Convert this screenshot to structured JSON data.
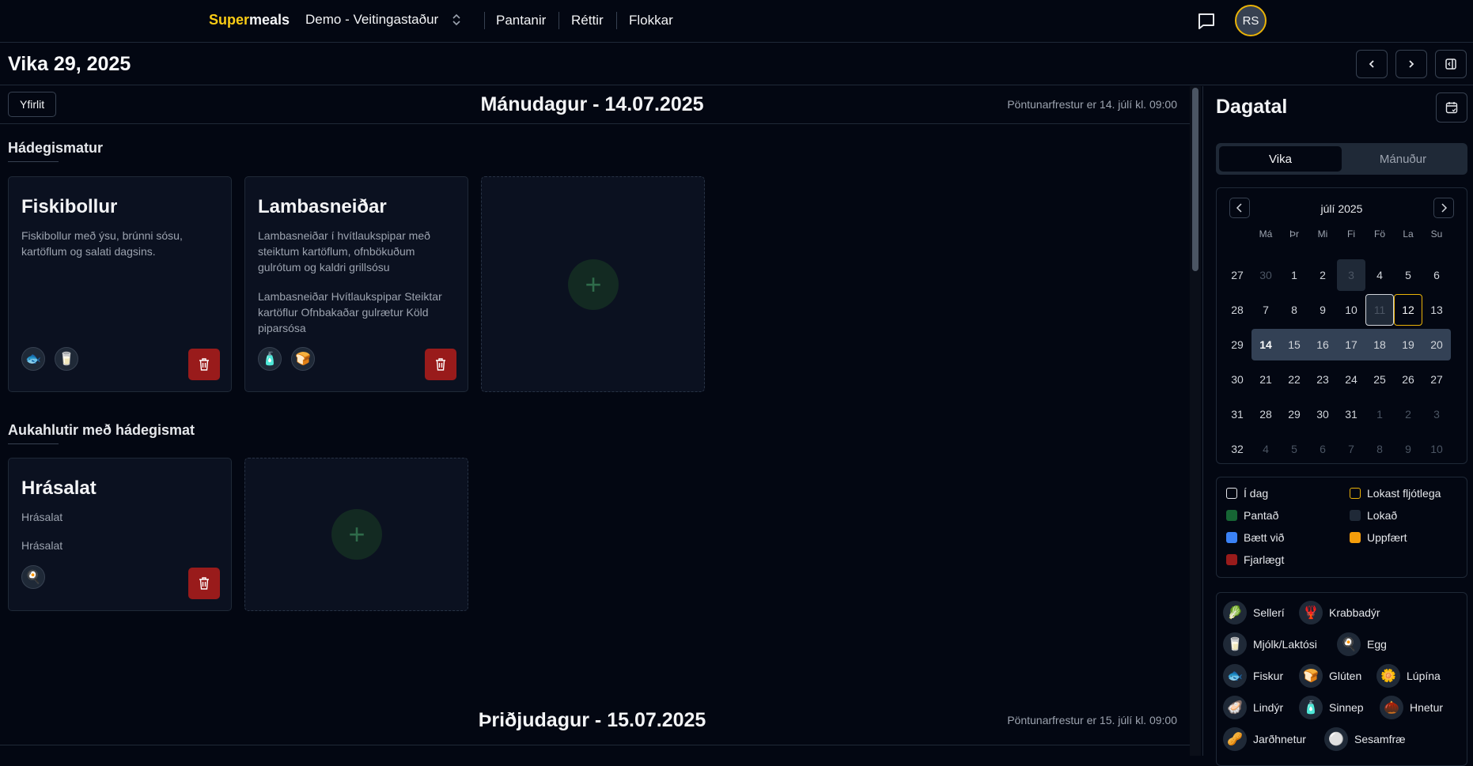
{
  "header": {
    "brand_a": "Super",
    "brand_b": "meals",
    "venue": "Demo - Veitingastaður",
    "nav": [
      "Pantanir",
      "Réttir",
      "Flokkar"
    ],
    "avatar": "RS"
  },
  "week": {
    "title": "Vika 29, 2025"
  },
  "day1": {
    "overview_button": "Yfirlit",
    "title": "Mánudagur - 14.07.2025",
    "deadline": "Pöntunarfrestur er 14. júlí kl. 09:00",
    "sections": [
      {
        "name": "Hádegismatur",
        "cards": [
          {
            "title": "Fiskibollur",
            "desc": "Fiskibollur með ýsu, brúnni sósu, kartöflum og salati dagsins.",
            "desc2": "",
            "allergens": [
              "fish-icon",
              "milk-icon"
            ]
          },
          {
            "title": "Lambasneiðar",
            "desc": "Lambasneiðar í hvítlaukspipar með steiktum kartöflum, ofnbökuðum gulrótum og kaldri grillsósu",
            "desc2": "Lambasneiðar Hvítlaukspipar Steiktar kartöflur Ofnbakaðar gulrætur Köld piparsósa",
            "allergens": [
              "mustard-icon",
              "gluten-icon"
            ]
          }
        ]
      },
      {
        "name": "Aukahlutir með hádegismat",
        "cards": [
          {
            "title": "Hrásalat",
            "desc": "Hrásalat",
            "desc2": "Hrásalat",
            "allergens": [
              "egg-icon"
            ]
          }
        ]
      }
    ]
  },
  "day2": {
    "title": "Þriðjudagur - 15.07.2025",
    "deadline": "Pöntunarfrestur er 15. júlí kl. 09:00"
  },
  "sidebar": {
    "title": "Dagatal",
    "tabs": [
      "Vika",
      "Mánuður"
    ],
    "active_tab": "Vika",
    "calendar": {
      "month": "júlí 2025",
      "weekdays": [
        "Má",
        "Þr",
        "Mi",
        "Fi",
        "Fö",
        "La",
        "Su"
      ],
      "weeks": [
        {
          "wk": "27",
          "days": [
            "30",
            "1",
            "2",
            "3",
            "4",
            "5",
            "6"
          ]
        },
        {
          "wk": "28",
          "days": [
            "7",
            "8",
            "9",
            "10",
            "11",
            "12",
            "13"
          ]
        },
        {
          "wk": "29",
          "days": [
            "14",
            "15",
            "16",
            "17",
            "18",
            "19",
            "20"
          ]
        },
        {
          "wk": "30",
          "days": [
            "21",
            "22",
            "23",
            "24",
            "25",
            "26",
            "27"
          ]
        },
        {
          "wk": "31",
          "days": [
            "28",
            "29",
            "30",
            "31",
            "1",
            "2",
            "3"
          ]
        },
        {
          "wk": "32",
          "days": [
            "4",
            "5",
            "6",
            "7",
            "8",
            "9",
            "10"
          ]
        }
      ],
      "today": "11",
      "closing_soon": "12",
      "selected_week": "29"
    },
    "legend": [
      {
        "label": "Í dag",
        "color": "#030712"
      },
      {
        "label": "Lokast fljótlega",
        "color": "#eab308"
      },
      {
        "label": "Pantað",
        "color": "#166534"
      },
      {
        "label": "Lokað",
        "color": "#1f2937"
      },
      {
        "label": "Bætt við",
        "color": "#3b82f6"
      },
      {
        "label": "Uppfært",
        "color": "#f59e0b"
      },
      {
        "label": "Fjarlægt",
        "color": "#991b1b"
      }
    ],
    "allergens": [
      {
        "label": "Sellerí",
        "icon": "celery-icon",
        "glyph": "🥬"
      },
      {
        "label": "Krabbadýr",
        "icon": "crustacean-icon",
        "glyph": "🦞"
      },
      {
        "label": "Mjólk/Laktósi",
        "icon": "milk-icon",
        "glyph": "🥛"
      },
      {
        "label": "Egg",
        "icon": "egg-icon",
        "glyph": "🍳"
      },
      {
        "label": "Fiskur",
        "icon": "fish-icon",
        "glyph": "🐟"
      },
      {
        "label": "Glúten",
        "icon": "gluten-icon",
        "glyph": "🍞"
      },
      {
        "label": "Lúpína",
        "icon": "lupin-icon",
        "glyph": "🌼"
      },
      {
        "label": "Lindýr",
        "icon": "mollusc-icon",
        "glyph": "🦪"
      },
      {
        "label": "Sinnep",
        "icon": "mustard-icon",
        "glyph": "🧴"
      },
      {
        "label": "Hnetur",
        "icon": "nuts-icon",
        "glyph": "🌰"
      },
      {
        "label": "Jarðhnetur",
        "icon": "peanut-icon",
        "glyph": "🥜"
      },
      {
        "label": "Sesamfræ",
        "icon": "sesame-icon",
        "glyph": "⚪"
      }
    ]
  }
}
